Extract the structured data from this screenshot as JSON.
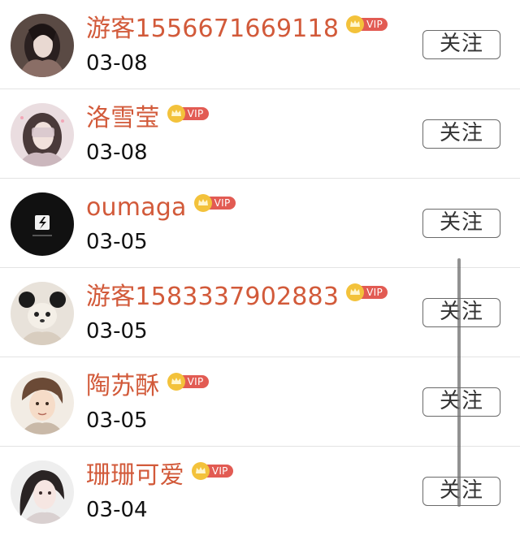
{
  "users": [
    {
      "name": "游客1556671669118",
      "date": "03-08",
      "badge": "VIP",
      "follow_label": "关注"
    },
    {
      "name": "洛雪莹",
      "date": "03-08",
      "badge": "VIP",
      "follow_label": "关注"
    },
    {
      "name": "oumaga",
      "date": "03-05",
      "badge": "VIP",
      "follow_label": "关注"
    },
    {
      "name": "游客1583337902883",
      "date": "03-05",
      "badge": "VIP",
      "follow_label": "关注"
    },
    {
      "name": "陶苏酥",
      "date": "03-05",
      "badge": "VIP",
      "follow_label": "关注"
    },
    {
      "name": "珊珊可爱",
      "date": "03-04",
      "badge": "VIP",
      "follow_label": "关注"
    }
  ],
  "colors": {
    "name": "#d25a3a",
    "vip_tag": "#e25b53",
    "crown": "#f3c23b",
    "divider": "#e3e3e3"
  },
  "icons": [
    "crown-icon"
  ]
}
